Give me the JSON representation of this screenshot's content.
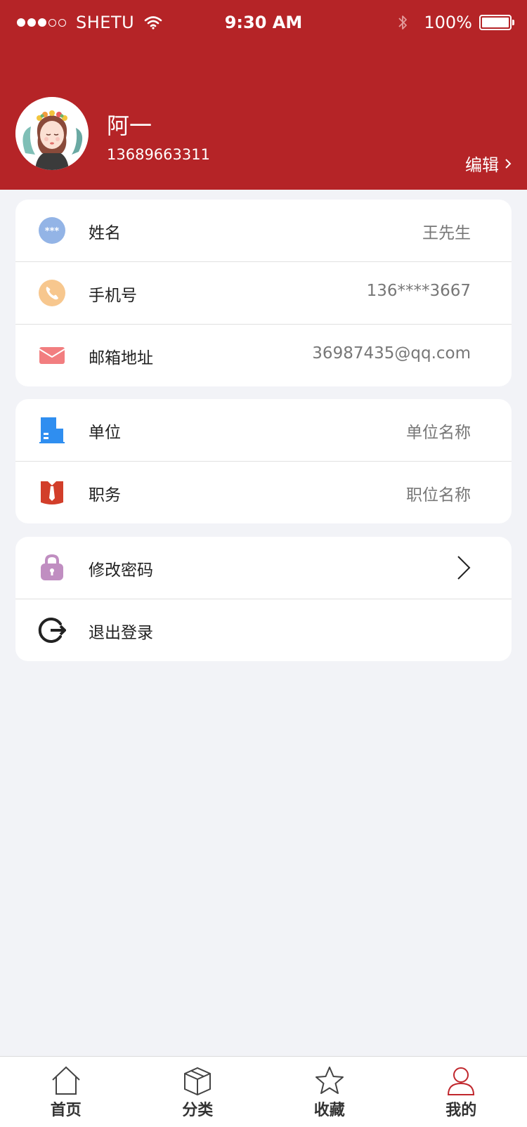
{
  "status_bar": {
    "carrier": "SHETU",
    "time": "9:30 AM",
    "battery": "100%"
  },
  "profile": {
    "name": "阿一",
    "phone": "13689663311",
    "edit_label": "编辑"
  },
  "info_card": {
    "rows": [
      {
        "label": "姓名",
        "value": "王先生",
        "icon": "password-badge-icon"
      },
      {
        "label": "手机号",
        "value": "136****3667",
        "icon": "phone-icon"
      },
      {
        "label": "邮箱地址",
        "value": "36987435@qq.com",
        "icon": "mail-icon"
      }
    ]
  },
  "work_card": {
    "rows": [
      {
        "label": "单位",
        "value": "单位名称",
        "icon": "building-icon"
      },
      {
        "label": "职务",
        "value": "职位名称",
        "icon": "tie-icon"
      }
    ]
  },
  "action_card": {
    "rows": [
      {
        "label": "修改密码",
        "icon": "lock-icon"
      },
      {
        "label": "退出登录",
        "icon": "logout-icon"
      }
    ]
  },
  "tabbar": {
    "items": [
      {
        "label": "首页",
        "icon": "home-icon"
      },
      {
        "label": "分类",
        "icon": "box-icon"
      },
      {
        "label": "收藏",
        "icon": "star-icon"
      },
      {
        "label": "我的",
        "icon": "user-icon",
        "active": true
      }
    ]
  },
  "colors": {
    "header_bg": "#b52427",
    "page_bg": "#f2f3f7",
    "active_tab": "#c0272d"
  }
}
